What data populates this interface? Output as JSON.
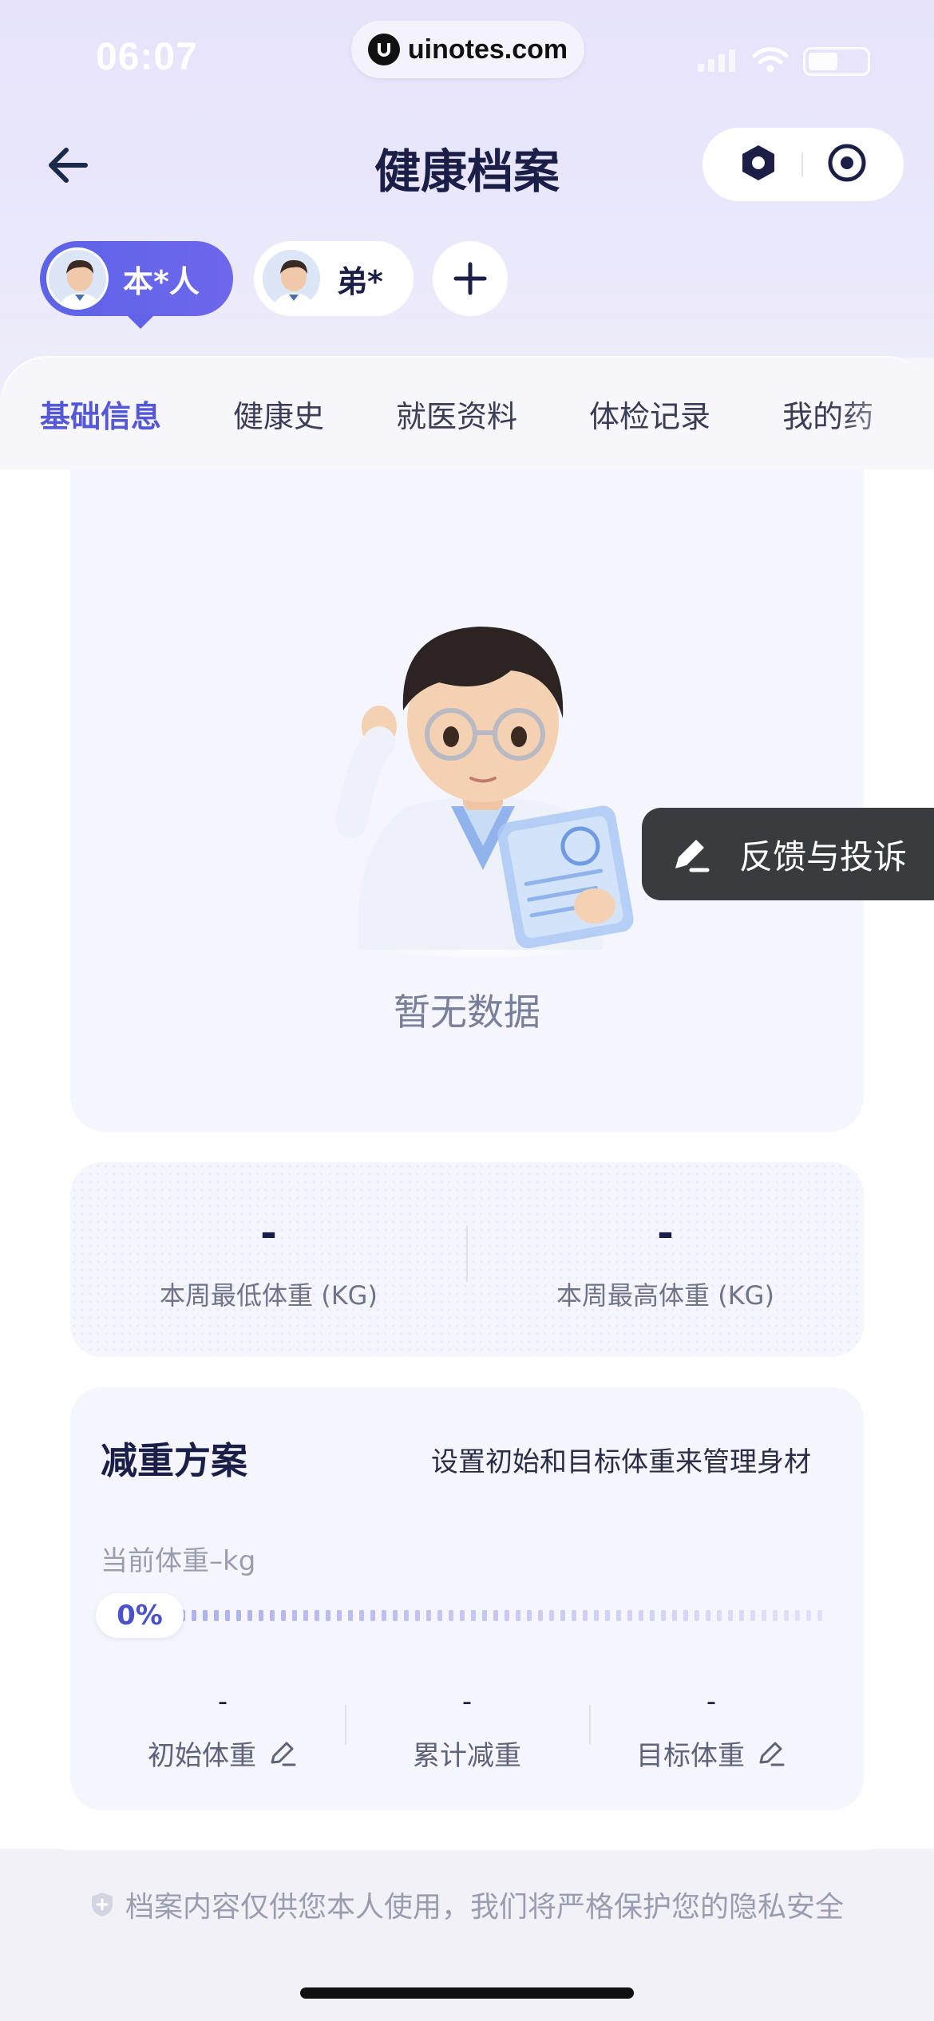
{
  "status_bar": {
    "time": "06:07",
    "url": "uinotes.com"
  },
  "header": {
    "title": "健康档案"
  },
  "members": [
    {
      "label": "本*人",
      "active": true
    },
    {
      "label": "弟*",
      "active": false
    }
  ],
  "tabs": [
    "基础信息",
    "健康史",
    "就医资料",
    "体检记录",
    "我的药"
  ],
  "empty_state": {
    "text": "暂无数据"
  },
  "feedback": {
    "label": "反馈与投诉"
  },
  "weekly_weight": {
    "min": {
      "value": "-",
      "label": "本周最低体重 (KG)"
    },
    "max": {
      "value": "-",
      "label": "本周最高体重 (KG)"
    }
  },
  "plan": {
    "title": "减重方案",
    "subtitle": "设置初始和目标体重来管理身材",
    "current_label": "当前体重–kg",
    "progress": "0%",
    "progress_value": 0,
    "columns": [
      {
        "value": "-",
        "label": "初始体重",
        "editable": true
      },
      {
        "value": "-",
        "label": "累计减重",
        "editable": false
      },
      {
        "value": "-",
        "label": "目标体重",
        "editable": true
      }
    ]
  },
  "footer": {
    "note": "档案内容仅供您本人使用，我们将严格保护您的隐私安全"
  },
  "colors": {
    "accent": "#5458d6",
    "chip_active": "#6063e7",
    "card_bg": "#f5f5fd"
  }
}
